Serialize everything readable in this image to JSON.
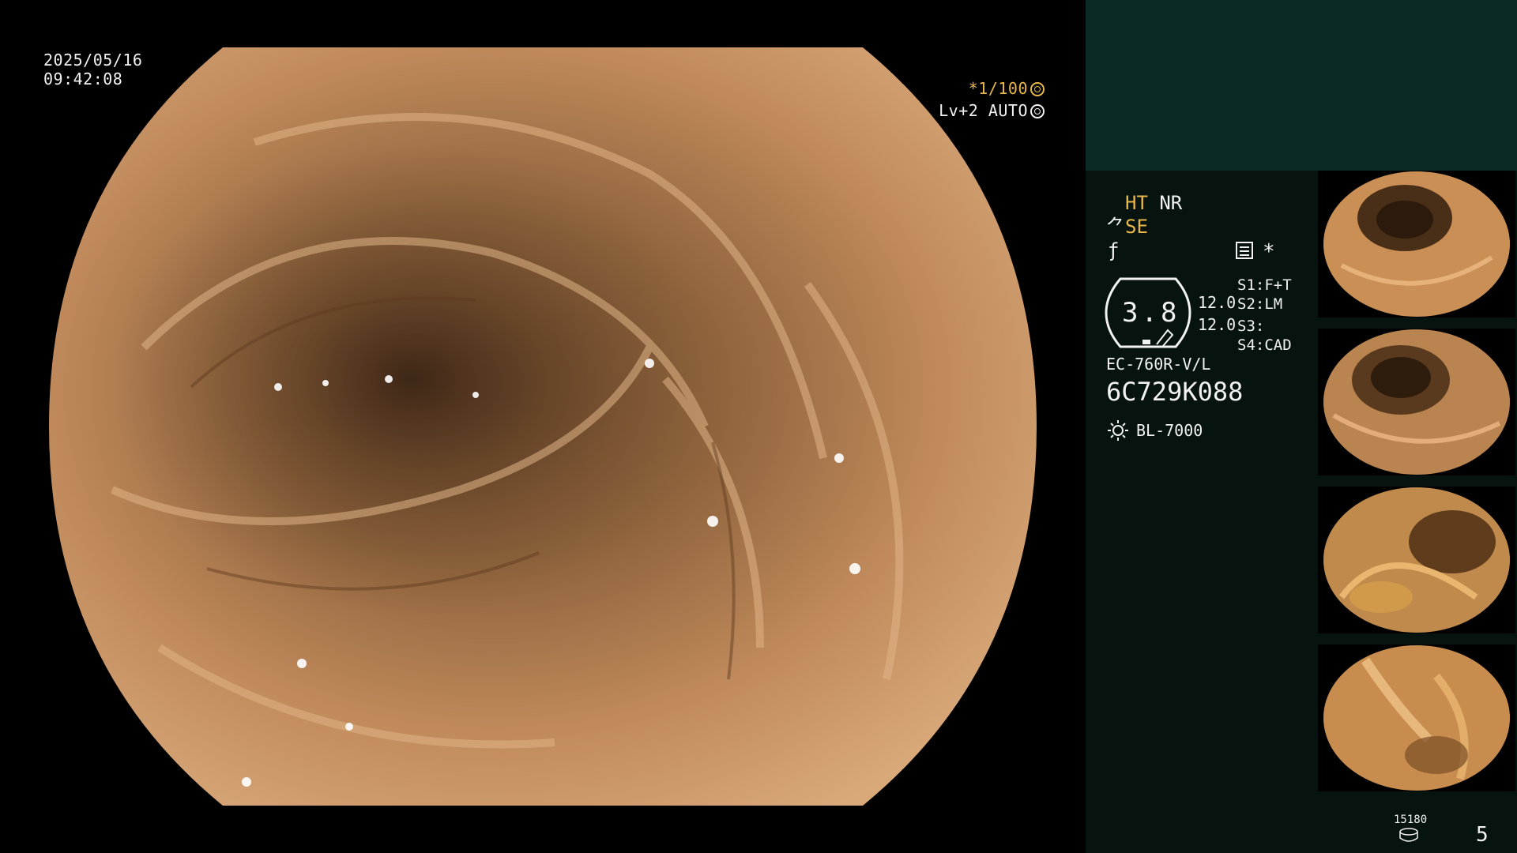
{
  "overlay": {
    "date": "2025/05/16",
    "time": "09:42:08",
    "shutter": "*1/100",
    "mode": "Lv+2 AUTO"
  },
  "panel": {
    "ht": "HT",
    "nr": "NR",
    "se": "SE",
    "asterisk": "*",
    "gauge_value": "3.8",
    "values": [
      "12.0",
      "12.0"
    ],
    "s_labels": [
      {
        "key": "S1:",
        "value": "F+T"
      },
      {
        "key": "S2:",
        "value": "LM"
      },
      {
        "key": "S3:",
        "value": ""
      },
      {
        "key": "S4:",
        "value": "CAD"
      }
    ],
    "scope_model": "EC-760R-V/L",
    "scope_serial": "6C729K088",
    "light_source": "BL-7000",
    "count": "15180",
    "page": "5"
  },
  "colors": {
    "accent_yellow": "#e8b74a",
    "panel_top": "#0c2a25",
    "panel_bg": "#07130f",
    "tissue": "#c08a5c"
  },
  "icons": [
    "shutter-icon",
    "auto-iris-icon",
    "structure-enhance-icon",
    "color-enhance-icon",
    "menu-icon",
    "light-source-icon",
    "disk-icon"
  ]
}
